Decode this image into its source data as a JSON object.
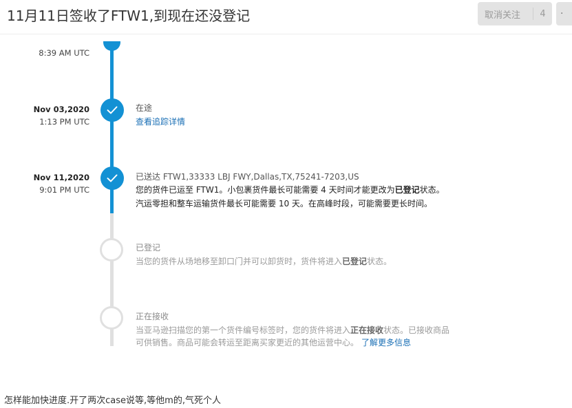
{
  "post": {
    "title": "11月11日签收了FTW1,到现在还没登记",
    "unfollow_label": "取消关注",
    "follow_count": "4",
    "more_label": "·"
  },
  "timeline": {
    "e0": {
      "time": "8:39 AM UTC"
    },
    "e1": {
      "date": "Nov 03,2020",
      "time": "1:13 PM UTC",
      "title": "在途",
      "link": "查看追踪详情"
    },
    "e2": {
      "date": "Nov 11,2020",
      "time": "9:01 PM UTC",
      "title": "已送达 FTW1,33333 LBJ FWY,Dallas,TX,75241-7203,US",
      "l1a": "您的货件已运至 FTW1。小包裹货件最长可能需要 4 天时间才能更改为",
      "l1b": "已登记",
      "l1c": "状态。",
      "l2": "汽运零担和整车运输货件最长可能需要 10 天。在高峰时段，可能需要更长时间。"
    },
    "e3": {
      "title": "已登记",
      "d1a": "当您的货件从场地移至卸口门并可以卸货时，货件将进入",
      "d1b": "已登记",
      "d1c": "状态。"
    },
    "e4": {
      "title": "正在接收",
      "d1a": "当亚马逊扫描您的第一个货件编号标签时，您的货件将进入",
      "d1b": "正在接收",
      "d1c": "状态。已接收商品",
      "d2a": "可供销售。商品可能会转运至距离买家更近的其他运营中心。",
      "d2link": "了解更多信息"
    }
  },
  "question": "怎样能加快进度.开了两次case说等,等他m的,气死个人",
  "colors": {
    "accent": "#1391d4",
    "pending": "#e0e0e0",
    "link": "#1a6fb5"
  }
}
